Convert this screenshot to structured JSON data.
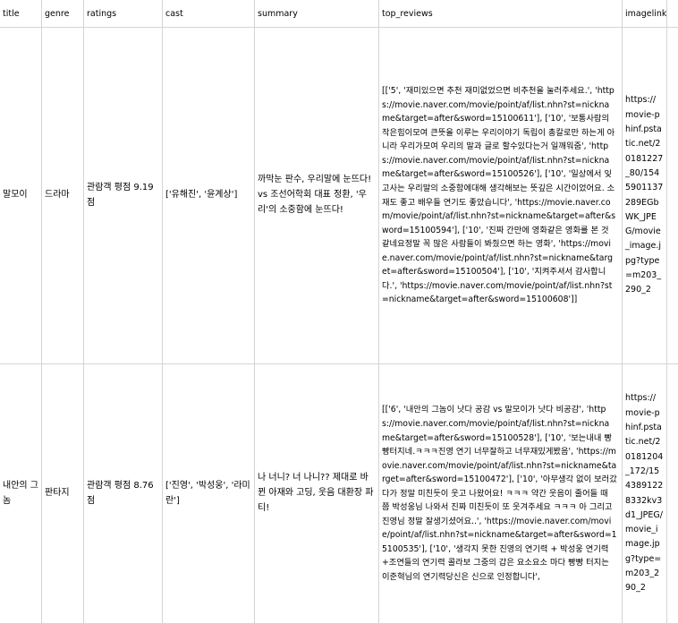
{
  "headers": {
    "title": "title",
    "genre": "genre",
    "ratings": "ratings",
    "cast": "cast",
    "summary": "summary",
    "top_reviews": "top_reviews",
    "imagelink": "imagelink"
  },
  "rows": [
    {
      "title": "말모이",
      "genre": "드라마",
      "ratings": "관람객 평점 9.19점",
      "cast": "['유해진', '윤계상']",
      "summary": "까막눈 판수, 우리말에 눈뜨다! vs 조선어학회 대표 정환, '우리'의 소중함에 눈뜨다!",
      "top_reviews": "[['5', '재미있으면 추천 재미없었으면 비추천을 눌러주세요.', 'https://movie.naver.com/movie/point/af/list.nhn?st=nickname&target=after&sword=15100611'], ['10', '보통사람의 작은힘이모여 큰뜻을 이루는 우리이야기 독립이 총칼로만 하는게 아니라 우리가모여 우리의 말과 글로 할수있다는거 일깨워줌', 'https://movie.naver.com/movie/point/af/list.nhn?st=nickname&target=after&sword=15100526'], ['10', '일상에서 잊고사는 우리말의 소중함에대해 생각해보는 뜻깊은 시간이었어요. 소재도 좋고 배우들 연기도 좋았습니다', 'https://movie.naver.com/movie/point/af/list.nhn?st=nickname&target=after&sword=15100594'], ['10', '진짜 간만에 영화같은 영화를 본 것 같네요정말 꼭 많은 사람들이 봐줬으면 하는 영화', 'https://movie.naver.com/movie/point/af/list.nhn?st=nickname&target=after&sword=15100504'], ['10', '지켜주셔서 감사합니다.', 'https://movie.naver.com/movie/point/af/list.nhn?st=nickname&target=after&sword=15100608']]",
      "imagelink": "https://movie-phinf.pstatic.net/20181227_80/1545901137289EGbWK_JPEG/movie_image.jpg?type=m203_290_2"
    },
    {
      "title": "내안의 그놈",
      "genre": "판타지",
      "ratings": "관람객 평점 8.76점",
      "cast": "['진영', '박성웅', '라미란']",
      "summary": "나 너니? 너 나니?? 제대로 바뀐 아재와 고딩, 웃음 대환장 파티!",
      "top_reviews": "[['6', '내안의 그놈이 낫다 공감 vs 말모이가 낫다 비공감', 'https://movie.naver.com/movie/point/af/list.nhn?st=nickname&target=after&sword=15100528'], ['10', '보는내내 빵빵터지네.ㅋㅋㅋ진영 연기 너무잘하고 너무재밌게봤음', 'https://movie.naver.com/movie/point/af/list.nhn?st=nickname&target=after&sword=15100472'], ['10', '아무생각 없이 보러갔다가 정말 미친듯이 웃고 나왔어요! ㅋㅋㅋ 약간 웃음이 줄어들 때 쯤 박성웅님 나와서 진짜 미친듯이 또 웃겨주세요 ㅋㅋㅋ 아 그리고 진영님 정말 잘생기셨어요..', 'https://movie.naver.com/movie/point/af/list.nhn?st=nickname&target=after&sword=15100535'], ['10', '생각지 못한 진영의 연기력 + 박성웅 연기력 +조연들의 연기력 콜라보 그중의 갑은 요소요소 마다 빵빵 터지는 이준혁님의 연기력당신은 신으로 인정합니다',",
      "imagelink": "https://movie-phinf.pstatic.net/20181204_172/1543891228332kv3d1_JPEG/movie_image.jpg?type=m203_290_2"
    }
  ]
}
